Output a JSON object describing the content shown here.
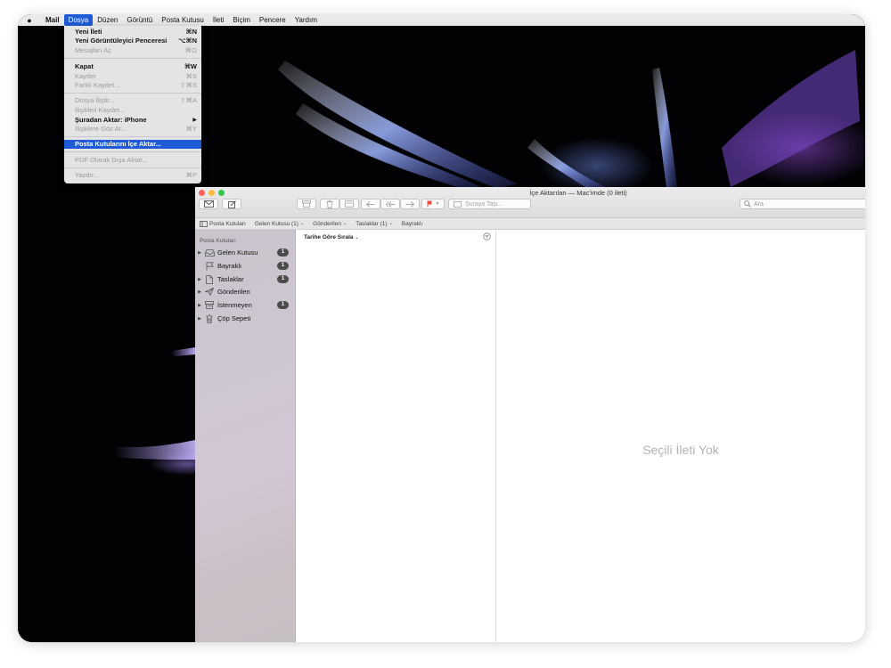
{
  "menubar": {
    "items": [
      "Mail",
      "Dosya",
      "Düzen",
      "Görüntü",
      "Posta Kutusu",
      "İleti",
      "Biçim",
      "Pencere",
      "Yardım"
    ],
    "active": "Dosya"
  },
  "file_menu": {
    "items": [
      {
        "label": "Yeni İleti",
        "shortcut": "⌘N",
        "state": "enabled"
      },
      {
        "label": "Yeni Görüntüleyici Penceresi",
        "shortcut": "⌥⌘N",
        "state": "enabled"
      },
      {
        "label": "Mesajları Aç",
        "shortcut": "⌘O",
        "state": "disabled"
      },
      {
        "label": "Kapat",
        "shortcut": "⌘W",
        "state": "enabled"
      },
      {
        "label": "Kaydet",
        "shortcut": "⌘S",
        "state": "disabled"
      },
      {
        "label": "Farklı Kaydet...",
        "shortcut": "⇧⌘S",
        "state": "disabled"
      },
      {
        "label": "Dosya İliştir...",
        "shortcut": "⇧⌘A",
        "state": "disabled"
      },
      {
        "label": "İlişikleri Kaydet...",
        "shortcut": "",
        "state": "disabled"
      },
      {
        "label": "Şuradan Aktar: iPhone",
        "shortcut": "▶",
        "state": "enabled"
      },
      {
        "label": "İlişiklere Göz At...",
        "shortcut": "⌘Y",
        "state": "disabled"
      },
      {
        "label": "Posta Kutularını İçe Aktar...",
        "shortcut": "",
        "state": "highlight"
      },
      {
        "label": "PDF Olarak Dışa Aktar...",
        "shortcut": "",
        "state": "disabled"
      },
      {
        "label": "Yazdır...",
        "shortcut": "⌘P",
        "state": "disabled"
      }
    ]
  },
  "window": {
    "title": "İçe Aktarılan — Mac'imde (0 ileti)",
    "move_placeholder": "Şuraya Taşı...",
    "search_placeholder": "Ara"
  },
  "favorites": {
    "mailboxes": "Posta Kutuları",
    "inbox": "Gelen Kutusu (1)",
    "sent": "Gönderilen",
    "drafts": "Taslaklar (1)",
    "flagged": "Bayraklı"
  },
  "sidebar": {
    "heading": "Posta Kutuları",
    "mailboxes": [
      {
        "label": "Gelen Kutusu",
        "count": "1",
        "icon": "inbox-icon",
        "disclosure": true
      },
      {
        "label": "Bayraklı",
        "count": "1",
        "icon": "flag-icon",
        "disclosure": false
      },
      {
        "label": "Taslaklar",
        "count": "1",
        "icon": "document-icon",
        "disclosure": true
      },
      {
        "label": "Gönderilen",
        "count": "",
        "icon": "paper-plane-icon",
        "disclosure": true
      },
      {
        "label": "İstenmeyen",
        "count": "1",
        "icon": "junk-icon",
        "disclosure": true
      },
      {
        "label": "Çöp Sepeti",
        "count": "",
        "icon": "trash-icon",
        "disclosure": true
      }
    ]
  },
  "message_list": {
    "sort_label": "Tarihe Göre Sırala"
  },
  "viewer": {
    "empty_text": "Seçili İleti Yok"
  },
  "colors": {
    "menu_highlight": "#1f5bd6",
    "badge": "#4b4b4b",
    "flag": "#f04a3e"
  }
}
